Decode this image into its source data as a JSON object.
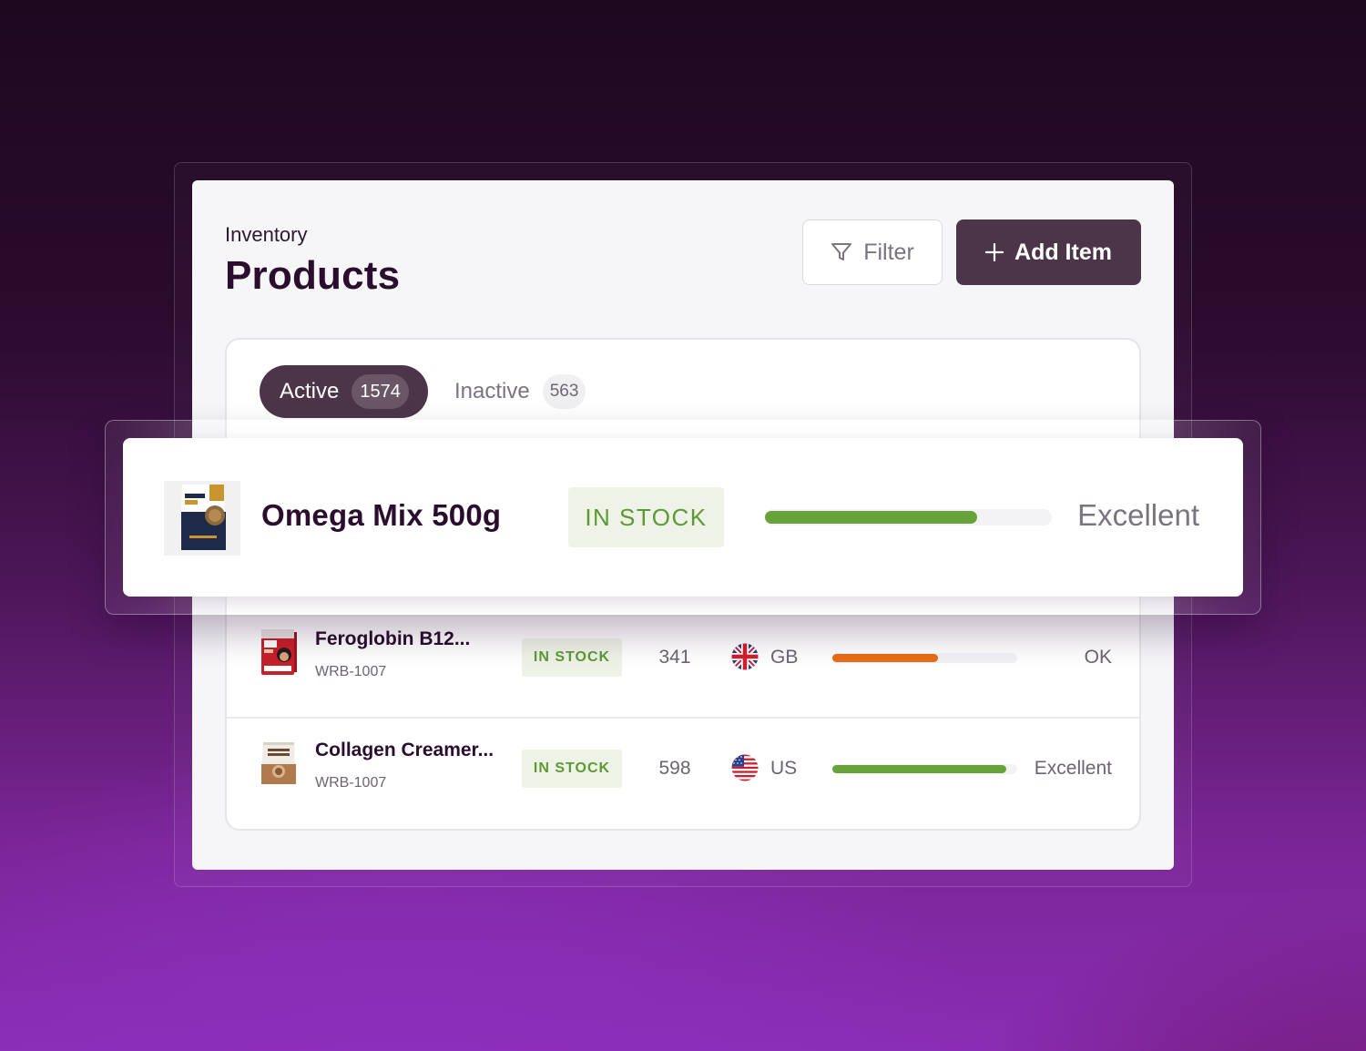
{
  "header": {
    "breadcrumb": "Inventory",
    "title": "Products",
    "filter_label": "Filter",
    "add_label": "Add Item"
  },
  "tabs": [
    {
      "label": "Active",
      "count": "1574",
      "selected": true
    },
    {
      "label": "Inactive",
      "count": "563",
      "selected": false
    }
  ],
  "highlighted": {
    "name": "Omega Mix 500g",
    "status": "IN STOCK",
    "level": 0.74,
    "rating": "Excellent",
    "bar_color": "#67a33a"
  },
  "rows": [
    {
      "name": "Feroglobin B12...",
      "sku": "WRB-1007",
      "status": "IN STOCK",
      "qty": "341",
      "flag": "uk-flag-icon",
      "country": "GB",
      "level": 0.57,
      "bar_color": "#e96d16",
      "rating": "OK"
    },
    {
      "name": "Collagen Creamer...",
      "sku": "WRB-1007",
      "status": "IN STOCK",
      "qty": "598",
      "flag": "us-flag-icon",
      "country": "US",
      "level": 0.94,
      "bar_color": "#67a33a",
      "rating": "Excellent"
    }
  ],
  "colors": {
    "primary": "#4d3549",
    "title": "#2b0d2e",
    "stock_green": "#5e9a34",
    "stock_bg": "#eef2e7"
  }
}
